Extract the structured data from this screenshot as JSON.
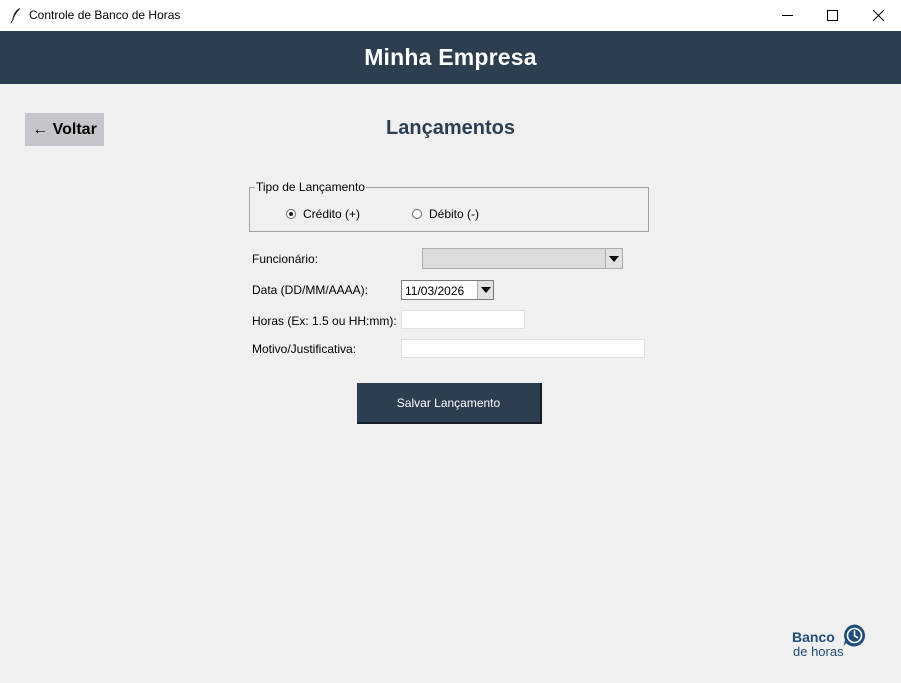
{
  "window": {
    "title": "Controle de Banco de Horas",
    "icon": "feather-icon"
  },
  "header": {
    "company": "Minha Empresa"
  },
  "nav": {
    "back_label": "← Voltar"
  },
  "page": {
    "title": "Lançamentos"
  },
  "type_group": {
    "legend": "Tipo de Lançamento",
    "options": [
      {
        "label": "Crédito (+)",
        "checked": true
      },
      {
        "label": "Débito (-)",
        "checked": false
      }
    ]
  },
  "form": {
    "employee_label": "Funcionário:",
    "employee_value": "",
    "date_label": "Data (DD/MM/AAAA):",
    "date_value": "11/03/2026",
    "hours_label": "Horas (Ex: 1.5 ou HH:mm):",
    "hours_value": "",
    "reason_label": "Motivo/Justificativa:",
    "reason_value": "",
    "save_label": "Salvar Lançamento"
  },
  "logo": {
    "line1": "Banco",
    "line2": "de horas"
  },
  "colors": {
    "primary": "#2c3e50",
    "back_button": "#c3c7cb",
    "background": "#f0f0f0",
    "logo": "#1f4e79"
  }
}
